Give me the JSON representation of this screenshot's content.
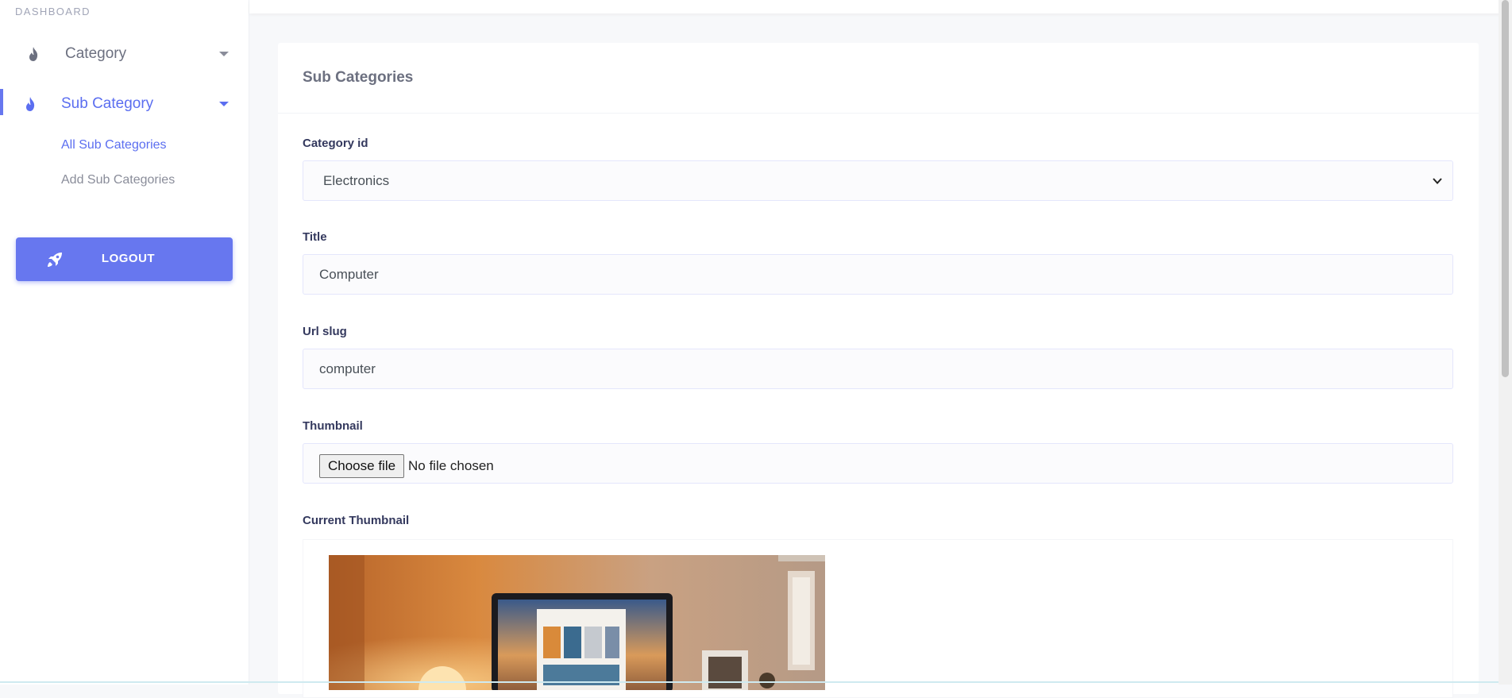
{
  "sidebar": {
    "heading": "DASHBOARD",
    "items": [
      {
        "label": "Category",
        "icon": "fire-icon",
        "active": false
      },
      {
        "label": "Sub Category",
        "icon": "fire-icon",
        "active": true
      }
    ],
    "sub_items": [
      {
        "label": "All Sub Categories",
        "current": true
      },
      {
        "label": "Add Sub Categories",
        "current": false
      }
    ],
    "logout": {
      "label": "LOGOUT",
      "icon": "rocket-icon"
    }
  },
  "card": {
    "title": "Sub Categories"
  },
  "form": {
    "category": {
      "label": "Category id",
      "value": "Electronics"
    },
    "title": {
      "label": "Title",
      "value": "Computer"
    },
    "slug": {
      "label": "Url slug",
      "value": "computer"
    },
    "thumbnail": {
      "label": "Thumbnail",
      "button": "Choose file",
      "status": "No file chosen"
    },
    "current_thumbnail": {
      "label": "Current Thumbnail"
    }
  },
  "colors": {
    "accent": "#6777ef",
    "sidebar_bg": "#ffffff",
    "page_bg": "#f7f8fa"
  }
}
